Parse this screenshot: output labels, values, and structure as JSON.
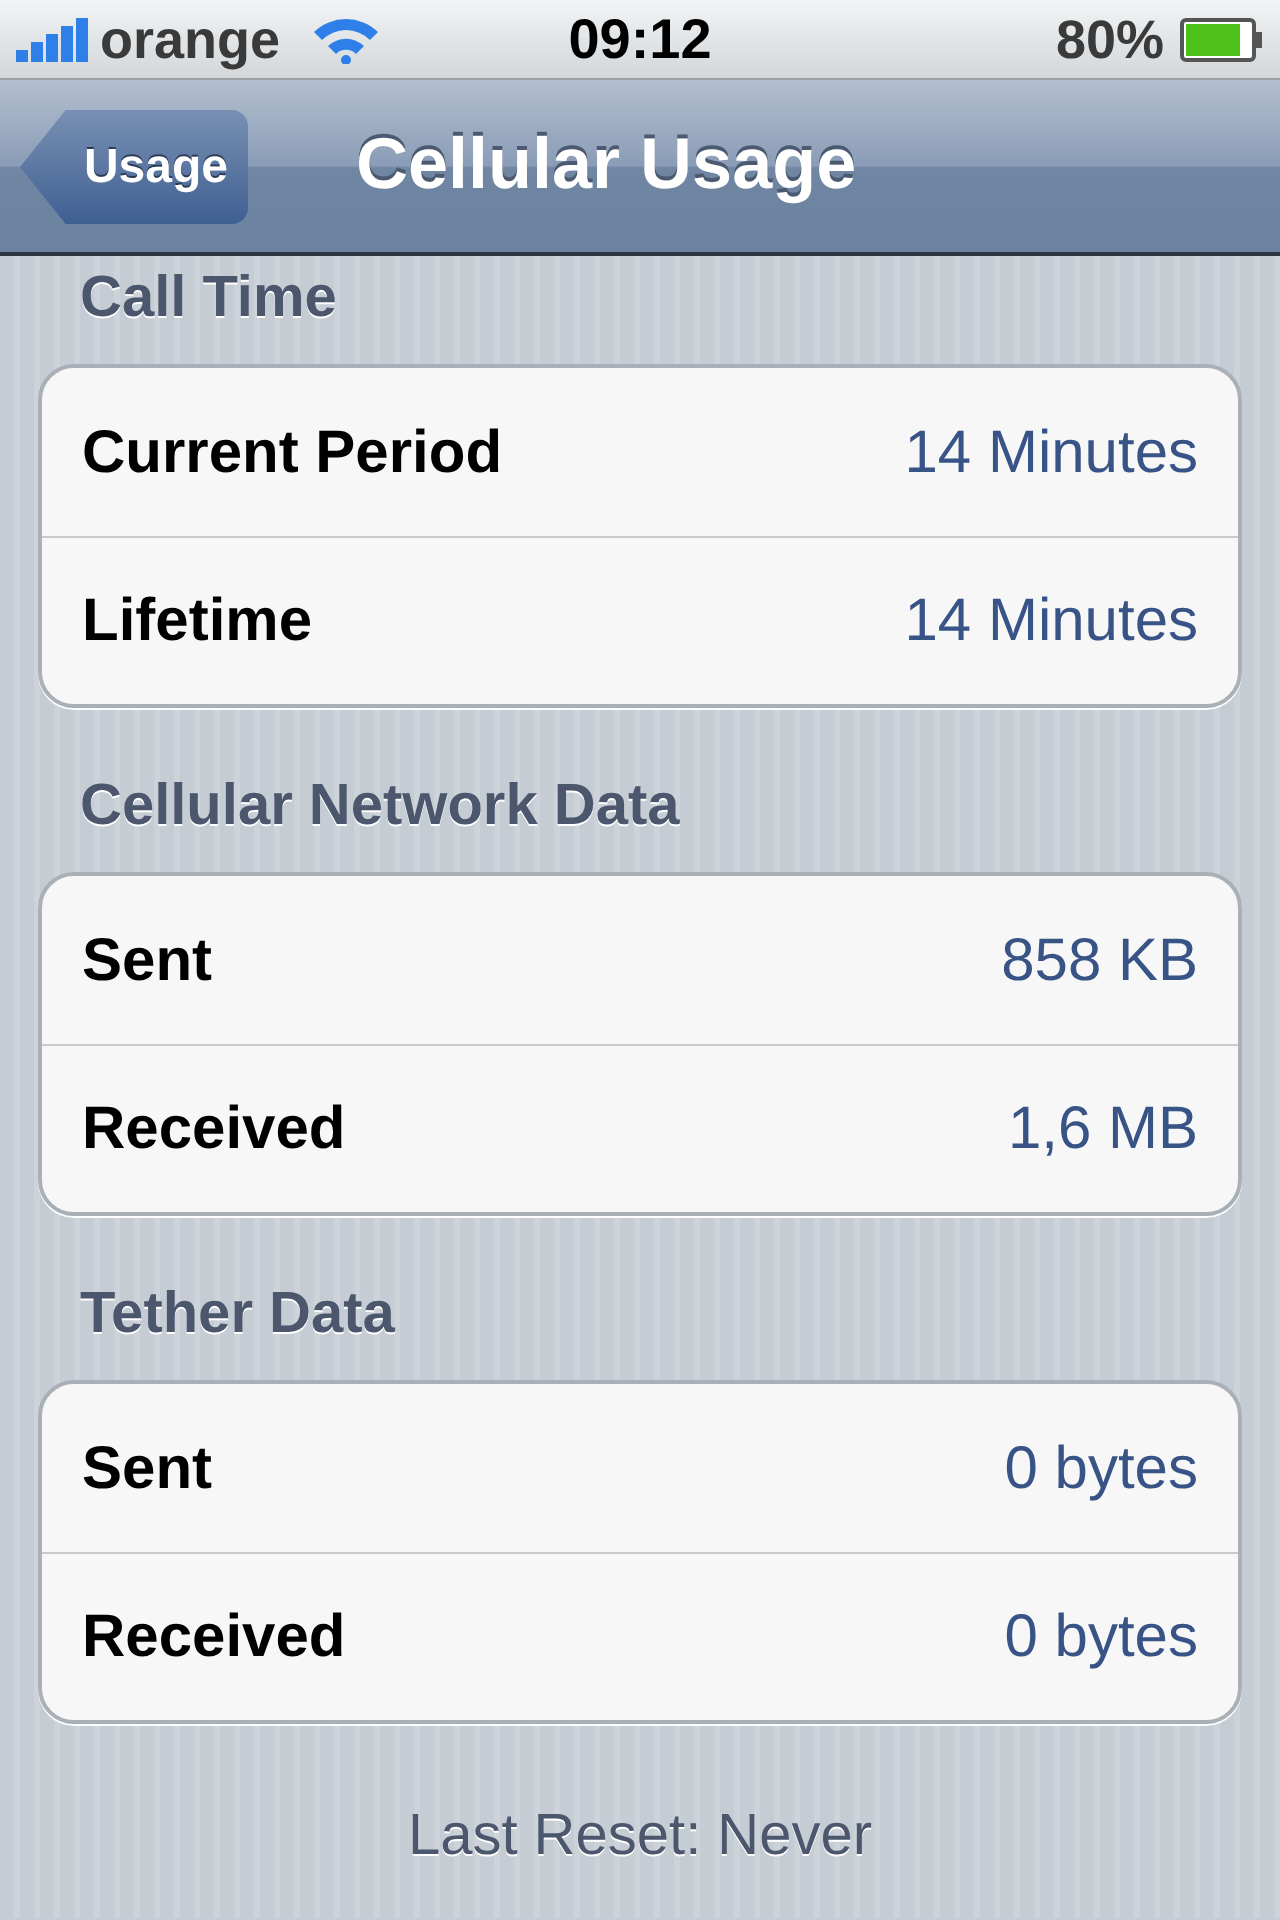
{
  "status_bar": {
    "carrier": "orange",
    "time": "09:12",
    "battery": "80%"
  },
  "nav_bar": {
    "back_button": "Usage",
    "title": "Cellular Usage"
  },
  "sections": [
    {
      "header": "Call Time",
      "rows": [
        {
          "label": "Current Period",
          "value": "14 Minutes"
        },
        {
          "label": "Lifetime",
          "value": "14 Minutes"
        }
      ]
    },
    {
      "header": "Cellular Network Data",
      "rows": [
        {
          "label": "Sent",
          "value": "858 KB"
        },
        {
          "label": "Received",
          "value": "1,6 MB"
        }
      ]
    },
    {
      "header": "Tether Data",
      "rows": [
        {
          "label": "Sent",
          "value": "0 bytes"
        },
        {
          "label": "Received",
          "value": "0 bytes"
        }
      ]
    }
  ],
  "footer": "Last Reset: Never"
}
